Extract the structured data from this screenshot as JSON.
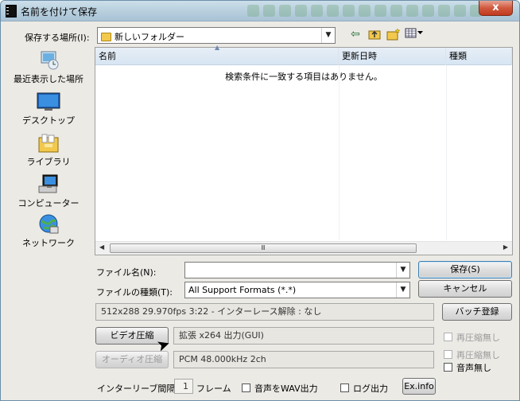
{
  "window": {
    "title": "名前を付けて保存",
    "close_label": "x"
  },
  "save_location": {
    "label": "保存する場所(I):",
    "value": "新しいフォルダー"
  },
  "places": [
    {
      "label": "最近表示した場所",
      "icon": "recent-places-icon"
    },
    {
      "label": "デスクトップ",
      "icon": "desktop-icon"
    },
    {
      "label": "ライブラリ",
      "icon": "libraries-icon"
    },
    {
      "label": "コンピューター",
      "icon": "computer-icon"
    },
    {
      "label": "ネットワーク",
      "icon": "network-icon"
    }
  ],
  "list": {
    "columns": [
      "名前",
      "更新日時",
      "種類"
    ],
    "empty_message": "検索条件に一致する項目はありません。",
    "scroll_glyph": "Ⅲ"
  },
  "filename": {
    "label": "ファイル名(N):",
    "value": ""
  },
  "filetype": {
    "label": "ファイルの種類(T):",
    "value": "All Support Formats (*.*)"
  },
  "buttons": {
    "save": "保存(S)",
    "cancel": "キャンセル",
    "batch": "バッチ登録"
  },
  "info_text": "512x288  29.970fps  3:22  -  インターレース解除 : なし",
  "video": {
    "button": "ビデオ圧縮",
    "value": "拡張 x264 出力(GUI)"
  },
  "audio": {
    "button": "オーディオ圧縮",
    "value": "PCM 48.000kHz 2ch"
  },
  "checkboxes": {
    "recompress_video": "再圧縮無し",
    "recompress_audio": "再圧縮無し",
    "no_audio": "音声無し",
    "wav_output": "音声をWAV出力",
    "log_output": "ログ出力"
  },
  "interleave": {
    "label": "インターリーブ間隔 :",
    "value": "1",
    "unit": "フレーム"
  },
  "exinfo_button": "Ex.info"
}
